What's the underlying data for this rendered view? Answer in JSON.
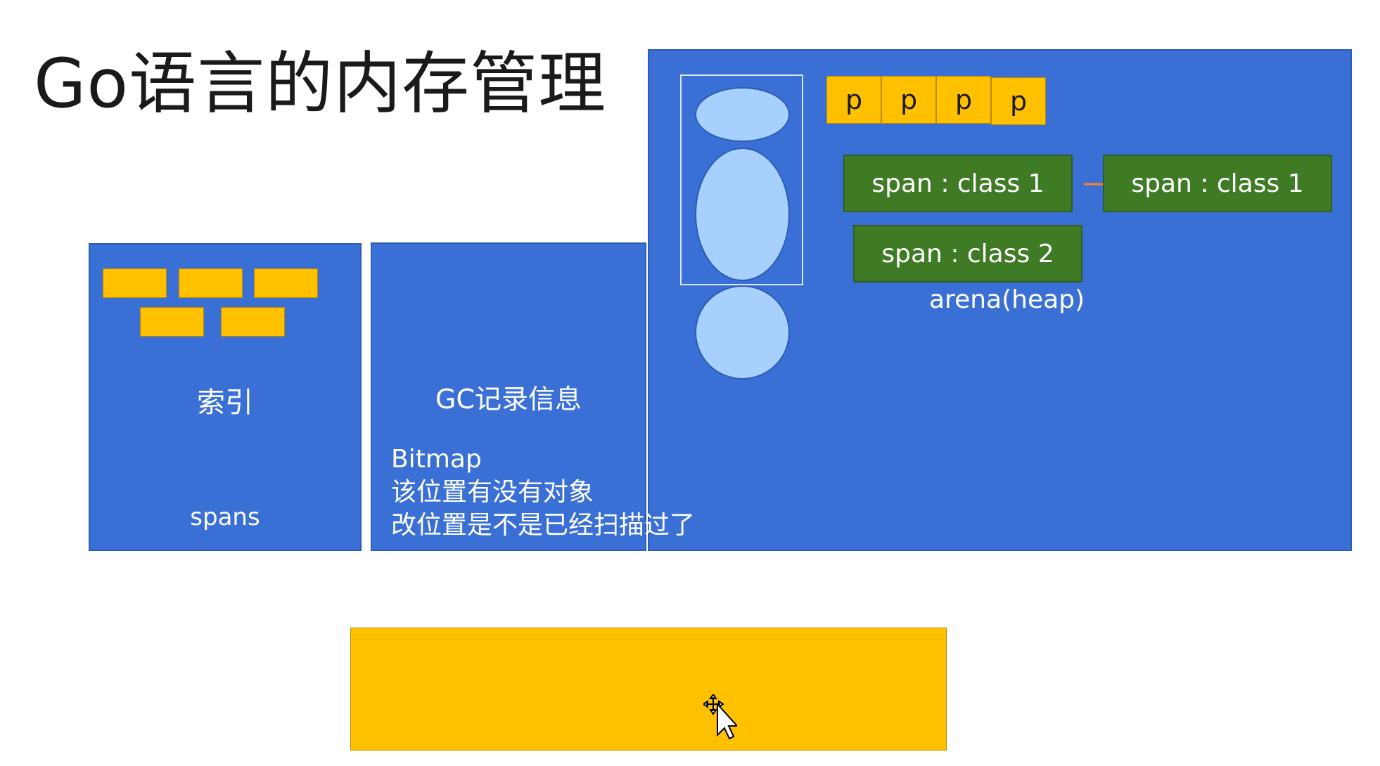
{
  "title": "Go语言的内存管理",
  "index_panel": {
    "label": "索引",
    "sublabel": "spans"
  },
  "gc_panel": {
    "label": "GC记录信息",
    "lines": [
      "Bitmap",
      "该位置有没有对象",
      "改位置是不是已经扫描过了"
    ]
  },
  "arena_panel": {
    "p_labels": [
      "p",
      "p",
      "p",
      "p"
    ],
    "spans": [
      "span : class 1",
      "span : class 1",
      "span : class 2"
    ],
    "label": "arena(heap)"
  },
  "colors": {
    "panel_blue": "#3a70d6",
    "block_yellow": "#ffc000",
    "span_green": "#3f7b25",
    "ellipse_blue": "#a8d0ff",
    "arrow_orange": "#ff7f2a"
  },
  "icons": {
    "cursor": "move-cursor-icon"
  }
}
